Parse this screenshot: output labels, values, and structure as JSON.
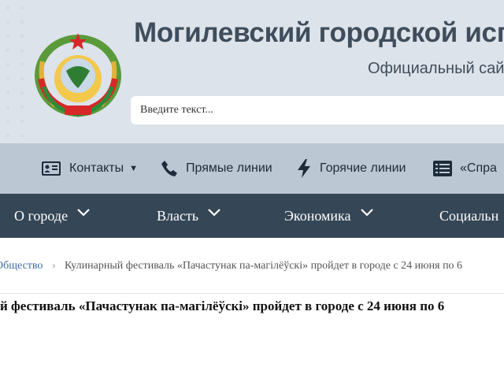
{
  "header": {
    "title": "Могилевский городской испол",
    "subtitle": "Официальный сайт",
    "search_placeholder": "Введите текст..."
  },
  "quicklinks": [
    {
      "label": "Контакты",
      "icon": "id-card-icon",
      "has_dropdown": true
    },
    {
      "label": "Прямые линии",
      "icon": "phone-icon"
    },
    {
      "label": "Горячие линии",
      "icon": "lightning-icon"
    },
    {
      "label": "«Спра",
      "icon": "list-icon"
    }
  ],
  "main_nav": [
    {
      "label": "О городе"
    },
    {
      "label": "Власть"
    },
    {
      "label": "Экономика"
    },
    {
      "label": "Социальн"
    }
  ],
  "breadcrumb": {
    "parent": "Общество",
    "separator": "›",
    "current": "Кулинарный фестиваль «Пачастунак па-магілёўскі» пройдет в городе с 24 июня по 6"
  },
  "article": {
    "title": "й фестиваль «Пачастунак па-магілёўскі» пройдет в городе с 24 июня по 6"
  },
  "colors": {
    "header_bg": "#dde3ea",
    "quicklinks_bg": "#bcc7d4",
    "nav_bg": "#354656",
    "link": "#3d6aa3"
  }
}
